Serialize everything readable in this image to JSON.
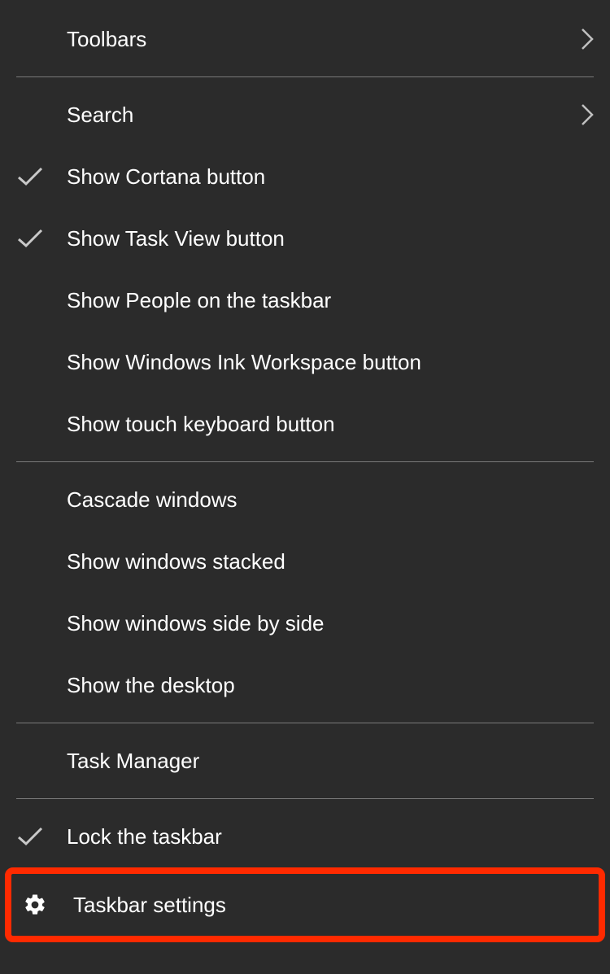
{
  "menu": {
    "sections": [
      {
        "items": [
          {
            "id": "toolbars",
            "label": "Toolbars",
            "checked": false,
            "submenu": true,
            "icon": null
          }
        ]
      },
      {
        "items": [
          {
            "id": "search",
            "label": "Search",
            "checked": false,
            "submenu": true,
            "icon": null
          },
          {
            "id": "show-cortana",
            "label": "Show Cortana button",
            "checked": true,
            "submenu": false,
            "icon": null
          },
          {
            "id": "show-task-view",
            "label": "Show Task View button",
            "checked": true,
            "submenu": false,
            "icon": null
          },
          {
            "id": "show-people",
            "label": "Show People on the taskbar",
            "checked": false,
            "submenu": false,
            "icon": null
          },
          {
            "id": "show-ink",
            "label": "Show Windows Ink Workspace button",
            "checked": false,
            "submenu": false,
            "icon": null
          },
          {
            "id": "show-touch-keyboard",
            "label": "Show touch keyboard button",
            "checked": false,
            "submenu": false,
            "icon": null
          }
        ]
      },
      {
        "items": [
          {
            "id": "cascade",
            "label": "Cascade windows",
            "checked": false,
            "submenu": false,
            "icon": null
          },
          {
            "id": "stacked",
            "label": "Show windows stacked",
            "checked": false,
            "submenu": false,
            "icon": null
          },
          {
            "id": "side-by-side",
            "label": "Show windows side by side",
            "checked": false,
            "submenu": false,
            "icon": null
          },
          {
            "id": "show-desktop",
            "label": "Show the desktop",
            "checked": false,
            "submenu": false,
            "icon": null
          }
        ]
      },
      {
        "items": [
          {
            "id": "task-manager",
            "label": "Task Manager",
            "checked": false,
            "submenu": false,
            "icon": null
          }
        ]
      },
      {
        "items": [
          {
            "id": "lock-taskbar",
            "label": "Lock the taskbar",
            "checked": true,
            "submenu": false,
            "icon": null
          },
          {
            "id": "taskbar-settings",
            "label": "Taskbar settings",
            "checked": false,
            "submenu": false,
            "icon": "gear",
            "highlighted": true
          }
        ]
      }
    ]
  },
  "colors": {
    "background": "#2b2b2b",
    "text": "#ffffff",
    "separator": "#7a7a7a",
    "highlight": "#ff2a00"
  }
}
